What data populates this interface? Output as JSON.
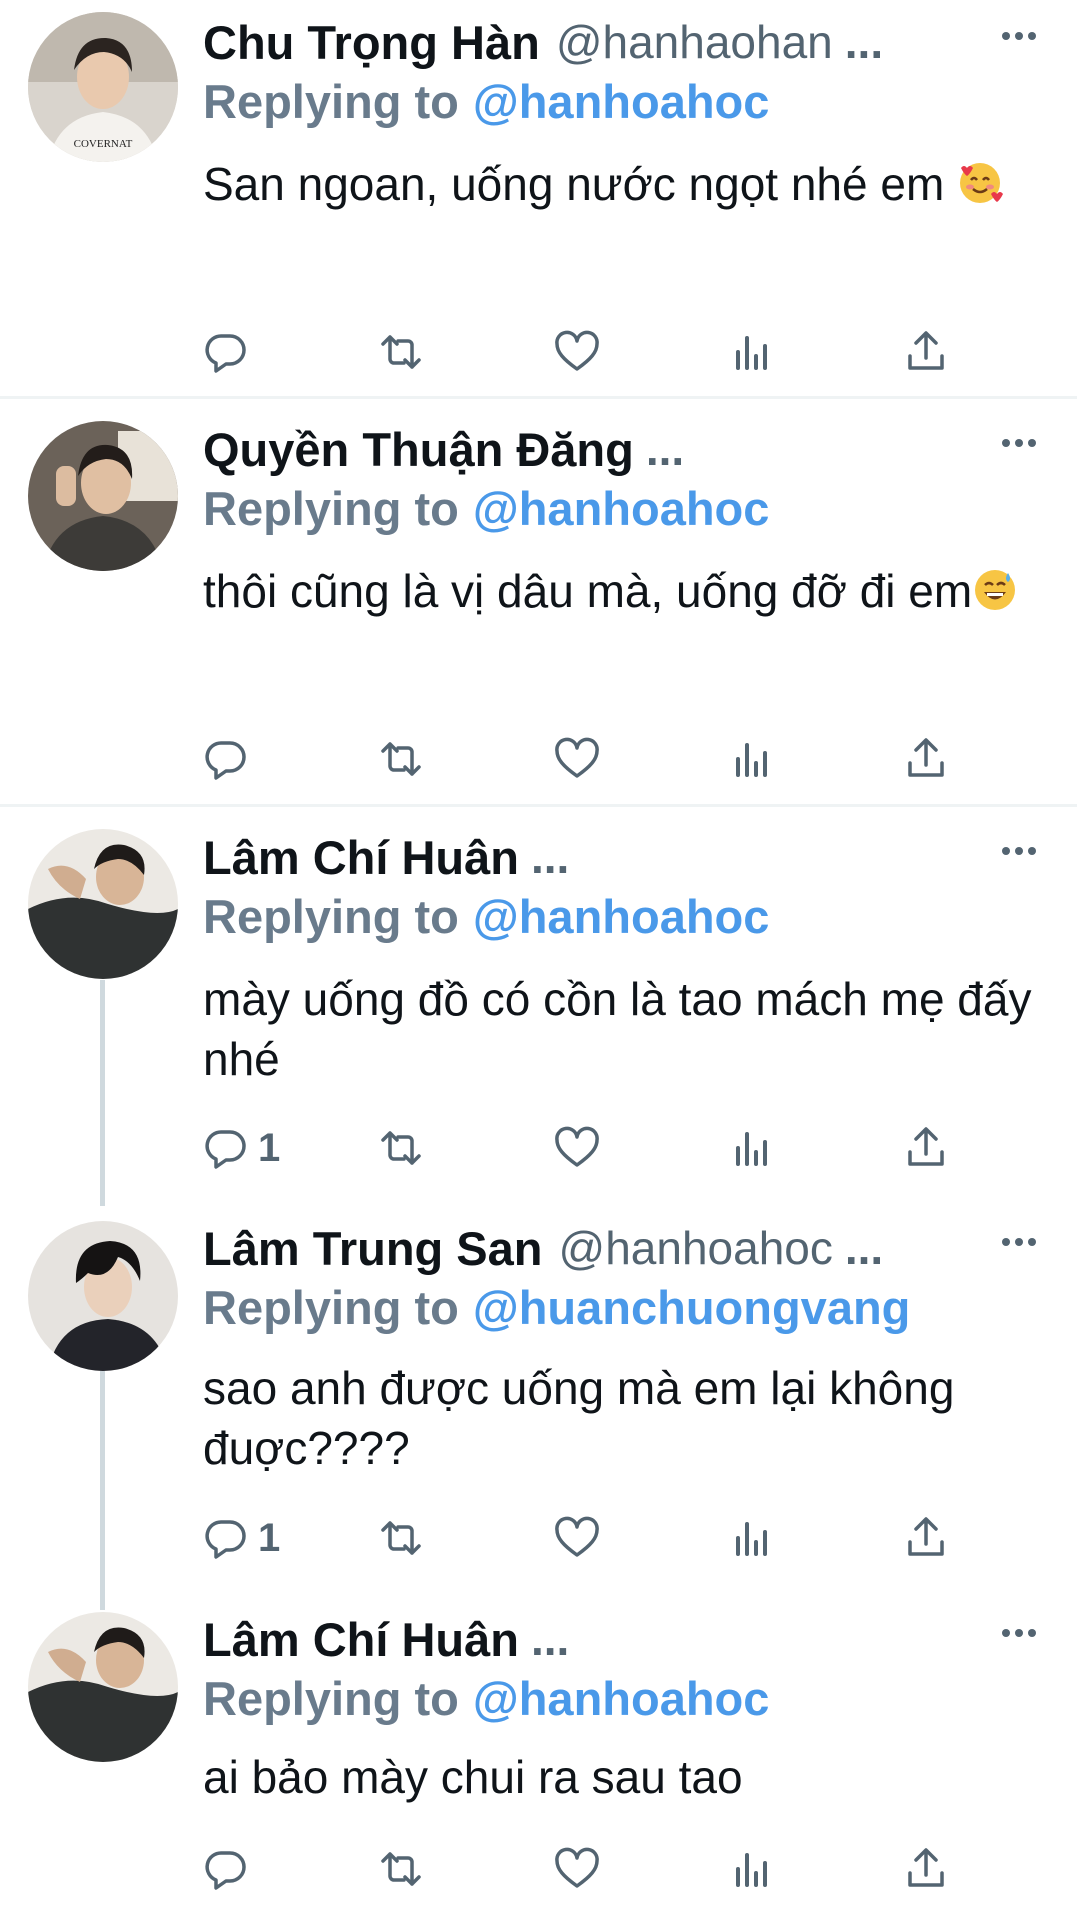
{
  "tweets": [
    {
      "name": "Chu Trọng Hàn",
      "handle": "@hanhaohan",
      "ellipsis": "...",
      "reply_prefix": "Replying to",
      "reply_handle": "@hanhoahoc",
      "text": "San ngoan, uống nước ngọt nhé em",
      "emoji": "smiling-face-with-hearts-emoji",
      "reply_count": "",
      "avatar_shirt_text": "COVERNAT"
    },
    {
      "name": "Quyền Thuận Đăng",
      "handle": "",
      "ellipsis": "...",
      "reply_prefix": "Replying to",
      "reply_handle": "@hanhoahoc",
      "text": "thôi cũng là vị dâu mà, uống đỡ đi em",
      "emoji": "grinning-face-with-sweat-emoji",
      "reply_count": ""
    },
    {
      "name": "Lâm Chí Huân",
      "handle": "",
      "ellipsis": "...",
      "reply_prefix": "Replying to",
      "reply_handle": "@hanhoahoc",
      "text": "mày uống đồ có cồn là tao mách mẹ đấy nhé",
      "reply_count": "1"
    },
    {
      "name": "Lâm Trung San",
      "handle": "@hanhoahoc",
      "ellipsis": "...",
      "reply_prefix": "Replying to",
      "reply_handle": "@huanchuongvang",
      "text": "sao anh được uống mà em lại không đuợc????",
      "reply_count": "1"
    },
    {
      "name": "Lâm Chí Huân",
      "handle": "",
      "ellipsis": "...",
      "reply_prefix": "Replying to",
      "reply_handle": "@hanhoahoc",
      "text": "ai bảo mày chui ra sau tao",
      "reply_count": ""
    }
  ],
  "icons": {
    "reply": "reply-icon",
    "retweet": "retweet-icon",
    "like": "heart-icon",
    "views": "views-icon",
    "share": "share-icon",
    "more": "more-icon"
  },
  "colors": {
    "link": "#4a99e9",
    "muted": "#697b8c",
    "icon": "#536471"
  }
}
